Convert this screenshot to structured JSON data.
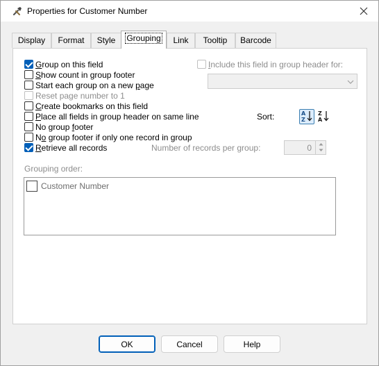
{
  "window": {
    "title": "Properties for Customer Number",
    "icon": "wrench-hammer-icon",
    "close_icon": "close-icon"
  },
  "tabs": [
    {
      "label": "Display",
      "active": false
    },
    {
      "label": "Format",
      "active": false
    },
    {
      "label": "Style",
      "active": false
    },
    {
      "label": "Grouping",
      "active": true
    },
    {
      "label": "Link",
      "active": false
    },
    {
      "label": "Tooltip",
      "active": false
    },
    {
      "label": "Barcode",
      "active": false
    }
  ],
  "options": [
    {
      "pre": "",
      "u": "G",
      "post": "roup on this field",
      "checked": true,
      "enabled": true
    },
    {
      "pre": "",
      "u": "S",
      "post": "how count in group footer",
      "checked": false,
      "enabled": true
    },
    {
      "pre": "Start each group on a new ",
      "u": "p",
      "post": "age",
      "checked": false,
      "enabled": true
    },
    {
      "pre": "",
      "u": "R",
      "post": "eset page number to 1",
      "checked": false,
      "enabled": false
    },
    {
      "pre": "",
      "u": "C",
      "post": "reate bookmarks on this field",
      "checked": false,
      "enabled": true
    },
    {
      "pre": "",
      "u": "P",
      "post": "lace all fields in group header on same line",
      "checked": false,
      "enabled": true
    },
    {
      "pre": "No group ",
      "u": "f",
      "post": "ooter",
      "checked": false,
      "enabled": true
    },
    {
      "pre": "N",
      "u": "o",
      "post": " group footer if only one record in group",
      "checked": false,
      "enabled": true
    },
    {
      "pre": "",
      "u": "R",
      "post": "etrieve all records",
      "checked": true,
      "enabled": true
    }
  ],
  "include_header": {
    "pre": "",
    "u": "I",
    "post": "nclude this field in group header for:",
    "checked": false,
    "enabled": false
  },
  "include_combo": {
    "value": ""
  },
  "sort": {
    "label": "Sort:",
    "ascending_icon": "sort-az-icon",
    "descending_icon": "sort-za-icon",
    "selected": "ascending"
  },
  "records_per_group": {
    "label": "Number of records per group:",
    "value": "0",
    "enabled": false
  },
  "grouping_order": {
    "label": "Grouping order:",
    "items": [
      {
        "label": "Customer Number",
        "checked": false
      }
    ]
  },
  "buttons": {
    "ok": "OK",
    "cancel": "Cancel",
    "help": "Help"
  },
  "colors": {
    "accent": "#005fb8",
    "disabled_text": "#8d8d8d",
    "dialog_bg": "#f0f0f0"
  }
}
